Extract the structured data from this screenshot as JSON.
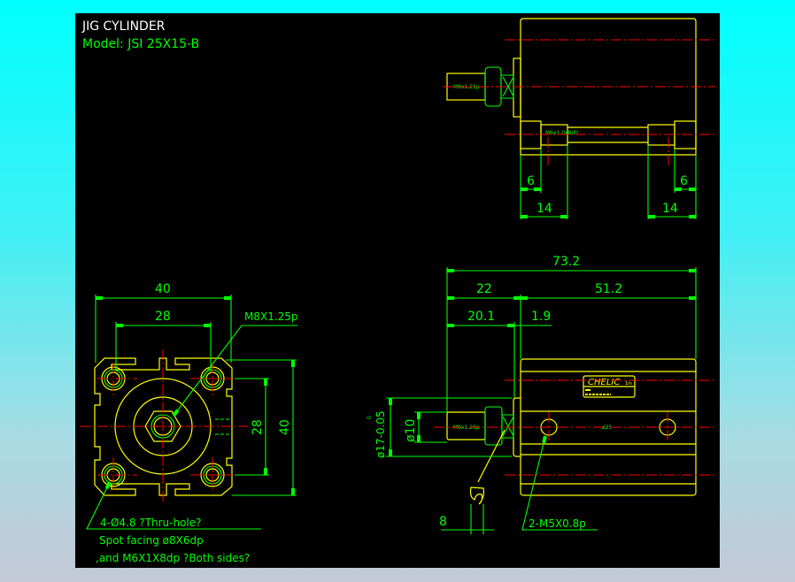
{
  "title": "JIG CYLINDER",
  "model": "Model:  JSI 25X15-B",
  "colors": {
    "background": "#000000",
    "outline": "#ffff00",
    "dimension": "#00ff00",
    "centerline": "#ff0000",
    "title": "#ffffff"
  },
  "front_view": {
    "dim_width_outer": "40",
    "dim_width_inner": "28",
    "dim_height_inner": "28",
    "dim_height_outer": "40",
    "rod_thread": "M8X1.25p",
    "notes": [
      "4-Ø4.8 ?Thru-hole?",
      "Spot facing  ø8X6dp",
      ",and M6X1X8dp ?Both sides?"
    ]
  },
  "top_view": {
    "rod_label": "M8x1.25p",
    "mount_label": "M6x1.0x8dh",
    "dim_left_small": "6",
    "dim_left_large": "14",
    "dim_right_small": "6",
    "dim_right_large": "14"
  },
  "side_view": {
    "dim_total": "73.2",
    "dim_rod": "22",
    "dim_body": "51.2",
    "dim_rod_ext": "20.1",
    "dim_flange": "1.9",
    "dim_bore_outer": "ø17-0.05",
    "dim_bore_tol": "0",
    "dim_rod_dia": "ø10",
    "dim_wrench": "8",
    "port_label": "2-M5X0.8p",
    "rod_label": "M8x1.25p",
    "bore_label": "ø25",
    "brand": "CHELIC",
    "brand_suffix": "1in"
  }
}
